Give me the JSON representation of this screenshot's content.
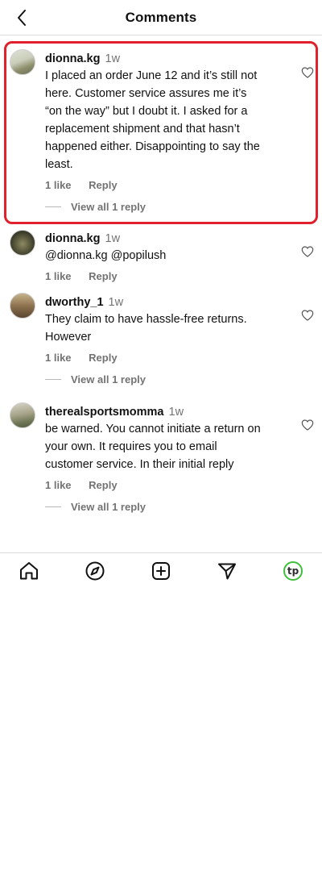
{
  "header": {
    "title": "Comments",
    "back_icon": "chevron-left-icon"
  },
  "comments": [
    {
      "username": "dionna.kg",
      "time": "1w",
      "text_lines": [
        "I placed an order June 12 and it’s still not",
        "here. Customer service assures me it’s",
        "“on the way” but I doubt it. I asked for a",
        "replacement shipment and that hasn’t",
        "happened either. Disappointing to say the",
        "least."
      ],
      "likes": "1 like",
      "reply_label": "Reply",
      "view_replies": "View all 1 reply",
      "highlighted": true
    },
    {
      "username": "dionna.kg",
      "time": "1w",
      "text_lines": [
        "@dionna.kg @popilush"
      ],
      "likes": "1 like",
      "reply_label": "Reply"
    },
    {
      "username": "dworthy_1",
      "time": "1w",
      "text_lines": [
        "They claim to have hassle-free returns.",
        "However"
      ],
      "likes": "1 like",
      "reply_label": "Reply",
      "view_replies": "View all 1 reply"
    },
    {
      "username": "therealsportsmomma",
      "time": "1w",
      "text_lines": [
        "be warned. You cannot initiate a return on",
        "your own. It requires you to email",
        "customer service. In their initial reply"
      ],
      "likes": "1 like",
      "reply_label": "Reply",
      "view_replies": "View all 1 reply"
    }
  ],
  "bottom_nav": {
    "items": [
      "home-icon",
      "explore-compass-icon",
      "new-post-icon",
      "direct-message-icon",
      "profile-avatar"
    ],
    "profile_initials": "tp"
  },
  "colors": {
    "highlight": "#e0202b",
    "muted": "#737373",
    "profile_ring": "#3fbf3a"
  }
}
